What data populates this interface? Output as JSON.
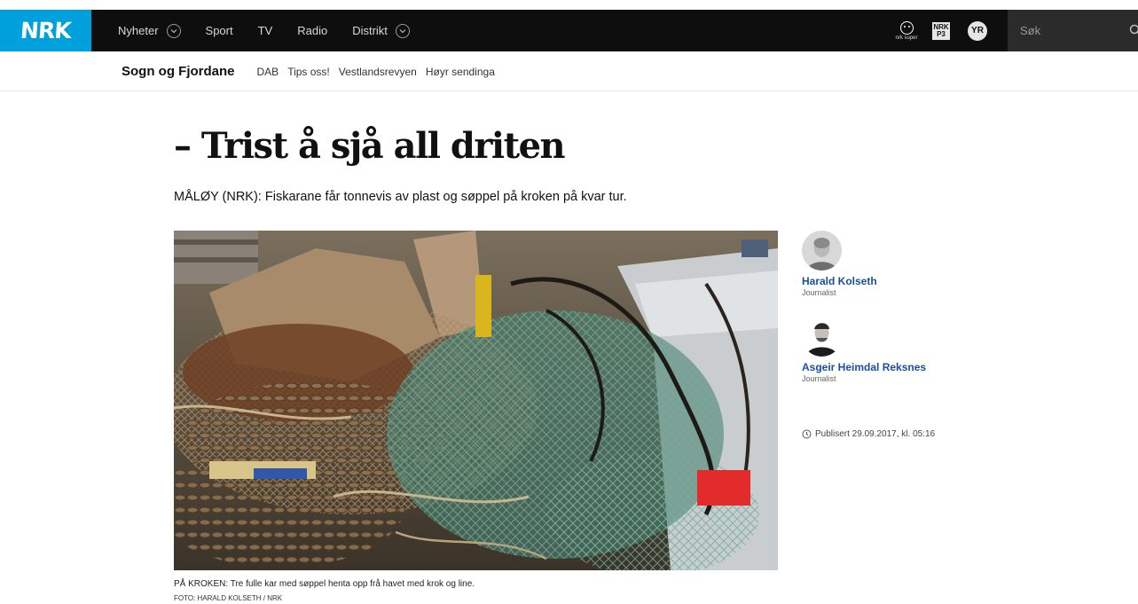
{
  "header": {
    "logo": "NRK",
    "nav": [
      {
        "label": "Nyheter",
        "has_dropdown": true
      },
      {
        "label": "Sport",
        "has_dropdown": false
      },
      {
        "label": "TV",
        "has_dropdown": false
      },
      {
        "label": "Radio",
        "has_dropdown": false
      },
      {
        "label": "Distrikt",
        "has_dropdown": true
      }
    ],
    "tools": {
      "super_label": "nrk super",
      "p3_label": "NRK P3",
      "yr_label": "YR"
    },
    "search": {
      "placeholder": "Søk"
    },
    "colors": {
      "bar": "#0e0e0e",
      "logo_bg": "#00a0dc"
    }
  },
  "subnav": {
    "region": "Sogn og Fjordane",
    "links": [
      "DAB",
      "Tips oss!",
      "Vestlandsrevyen",
      "Høyr sendinga"
    ]
  },
  "article": {
    "headline": "– Trist å sjå all driten",
    "lead": "MÅLØY (NRK): Fiskarane får tonnevis av plast og søppel på kroken på kvar tur.",
    "image_caption": "PÅ KROKEN: Tre fulle kar med søppel henta opp frå havet med krok og line.",
    "image_credit": "FOTO: HARALD KOLSETH / NRK"
  },
  "sidebar": {
    "authors": [
      {
        "name": "Harald Kolseth",
        "role": "Journalist"
      },
      {
        "name": "Asgeir Heimdal Reksnes",
        "role": "Journalist"
      }
    ],
    "published": "Publisert 29.09.2017, kl. 05:16",
    "link_color": "#1a4fa0"
  }
}
